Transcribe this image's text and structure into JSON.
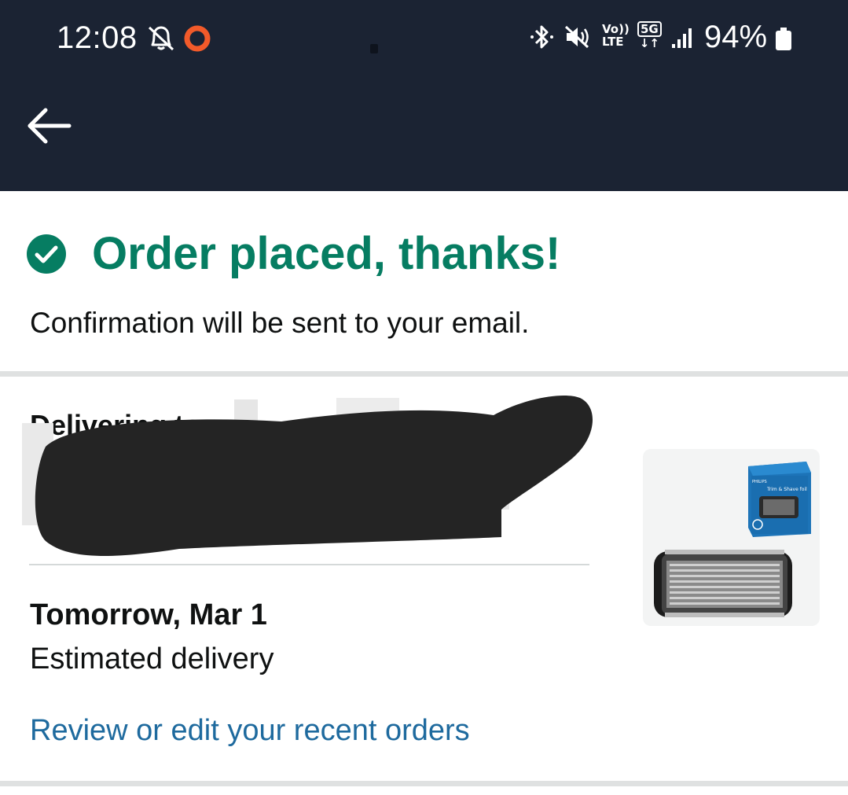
{
  "status_bar": {
    "time": "12:08",
    "battery": "94%",
    "volte_top": "Vo))",
    "volte_bottom": "LTE",
    "network": "5G",
    "icons": [
      "bell-off-icon",
      "recording-icon",
      "bluetooth-icon",
      "mute-icon",
      "signal-icon",
      "battery-icon"
    ]
  },
  "app_bar": {
    "back_icon": "arrow-left-icon"
  },
  "confirmation": {
    "title": "Order placed, thanks!",
    "subtitle": "Confirmation will be sent to your email."
  },
  "delivery": {
    "label": "Delivering to",
    "date": "Tomorrow, Mar 1",
    "estimate_label": "Estimated delivery",
    "review_link": "Review or edit your recent orders"
  },
  "product": {
    "package_brand": "PHILIPS",
    "package_text": "Trim & Shave foil"
  },
  "colors": {
    "header_bg": "#1b2333",
    "success_green": "#067d62",
    "link_blue": "#1e6a9e",
    "divider": "#dfe1e1"
  }
}
